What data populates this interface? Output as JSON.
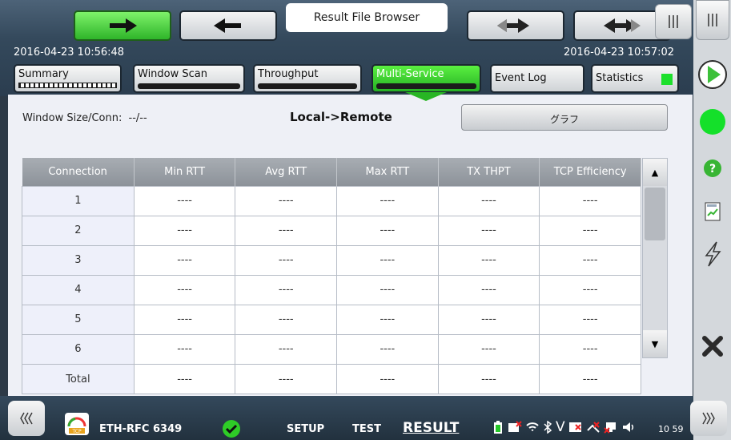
{
  "header": {
    "title": "Result File Browser",
    "start_time": "2016-04-23 10:56:48",
    "end_time": "2016-04-23 10:57:02"
  },
  "tabs": [
    {
      "label": "Summary"
    },
    {
      "label": "Window Scan"
    },
    {
      "label": "Throughput"
    },
    {
      "label": "Multi-Service"
    },
    {
      "label": "Event Log"
    },
    {
      "label": "Statistics"
    }
  ],
  "panel": {
    "window_size_label": "Window Size/Conn:",
    "window_size_value": "--/--",
    "direction": "Local->Remote",
    "graph_button": "グラフ"
  },
  "table": {
    "columns": [
      "Connection",
      "Min RTT",
      "Avg RTT",
      "Max RTT",
      "TX THPT",
      "TCP Efficiency"
    ],
    "rows": [
      [
        "1",
        "----",
        "----",
        "----",
        "----",
        "----"
      ],
      [
        "2",
        "----",
        "----",
        "----",
        "----",
        "----"
      ],
      [
        "3",
        "----",
        "----",
        "----",
        "----",
        "----"
      ],
      [
        "4",
        "----",
        "----",
        "----",
        "----",
        "----"
      ],
      [
        "5",
        "----",
        "----",
        "----",
        "----",
        "----"
      ],
      [
        "6",
        "----",
        "----",
        "----",
        "----",
        "----"
      ]
    ],
    "total": [
      "Total",
      "----",
      "----",
      "----",
      "----",
      "----"
    ]
  },
  "bottom": {
    "app_name": "ETH-RFC 6349",
    "app_icon_text": "TCP",
    "setup": "SETUP",
    "test": "TEST",
    "result": "RESULT",
    "v_label": "V",
    "clock": "10 59"
  },
  "colors": {
    "active_tab": "#25b024",
    "header_bg": "#34495c",
    "status_ok": "#1de02c"
  }
}
